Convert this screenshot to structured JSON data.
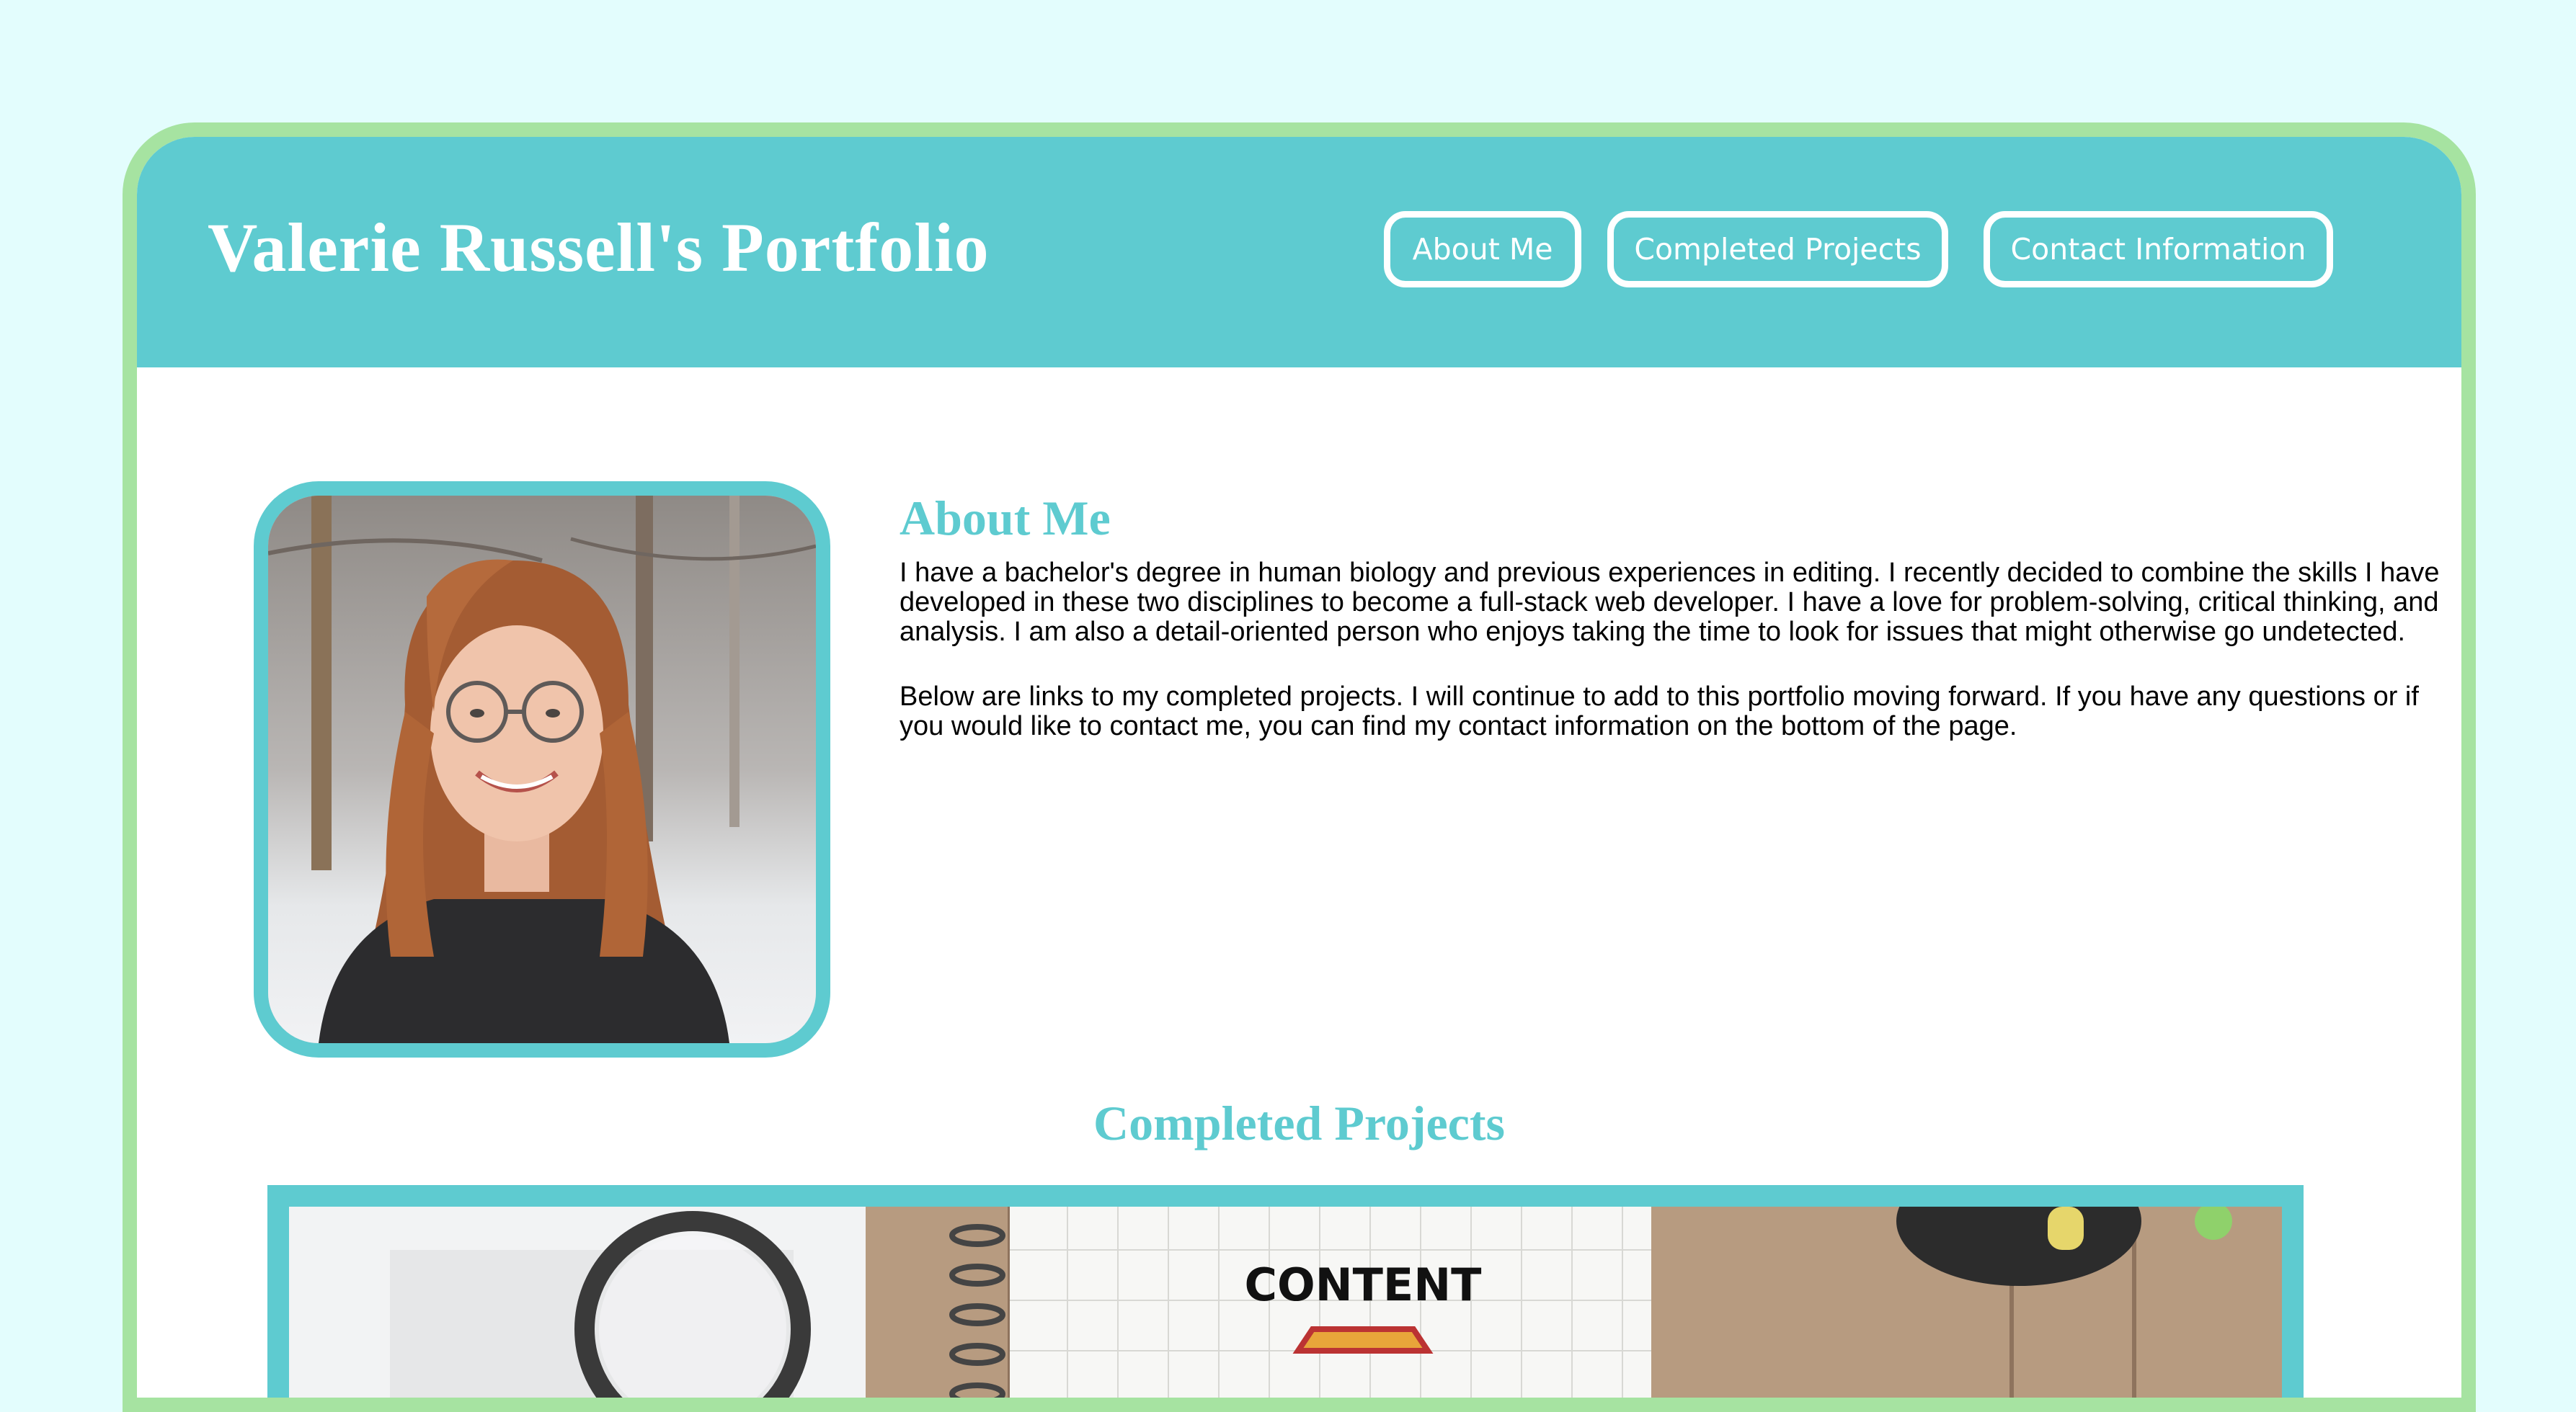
{
  "header": {
    "title": "Valerie Russell's Portfolio",
    "nav": [
      {
        "label": "About Me"
      },
      {
        "label": "Completed Projects"
      },
      {
        "label": "Contact Information"
      }
    ]
  },
  "about": {
    "heading": "About Me",
    "paragraphs": [
      "I have a bachelor's degree in human biology and previous experiences in editing. I recently decided to combine the skills I have developed in these two disciplines to become a full-stack web developer. I have a love for problem-solving, critical thinking, and analysis. I am also a detail-oriented person who enjoys taking the time to look for issues that might otherwise go undetected.",
      "Below are links to my completed projects. I will continue to add to this portfolio moving forward. If you have any questions or if you would like to contact me, you can find my contact information on the bottom of the page."
    ]
  },
  "projects": {
    "heading": "Completed Projects",
    "image_text": "CONTENT"
  },
  "colors": {
    "page_background": "#e3fdfd",
    "border": "#a6e3a1",
    "accent": "#5ecbd0",
    "header_text": "#ffffff"
  }
}
